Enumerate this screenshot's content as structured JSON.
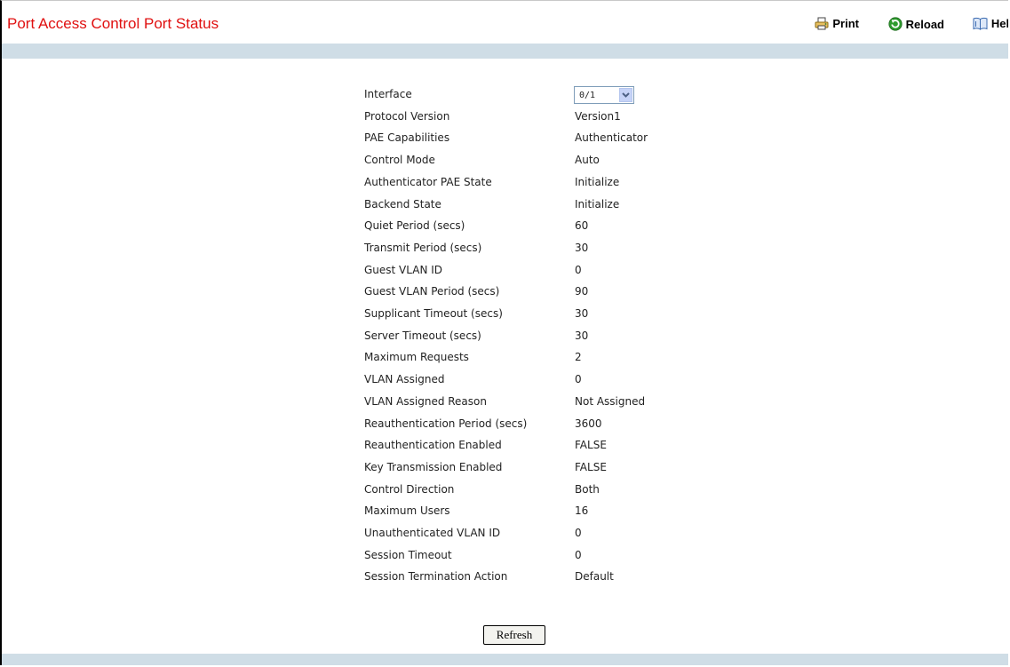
{
  "page": {
    "title": "Port Access Control Port Status"
  },
  "toolbar": {
    "print_label": "Print",
    "reload_label": "Reload",
    "help_label": "Help"
  },
  "form": {
    "interface": {
      "label": "Interface",
      "selected": "0/1"
    },
    "rows": [
      {
        "label": "Protocol Version",
        "value": "Version1"
      },
      {
        "label": "PAE Capabilities",
        "value": "Authenticator"
      },
      {
        "label": "Control Mode",
        "value": "Auto"
      },
      {
        "label": "Authenticator PAE State",
        "value": "Initialize"
      },
      {
        "label": "Backend State",
        "value": "Initialize"
      },
      {
        "label": "Quiet Period (secs)",
        "value": "60"
      },
      {
        "label": "Transmit Period (secs)",
        "value": "30"
      },
      {
        "label": "Guest VLAN ID",
        "value": "0"
      },
      {
        "label": "Guest VLAN Period (secs)",
        "value": "90"
      },
      {
        "label": "Supplicant Timeout (secs)",
        "value": "30"
      },
      {
        "label": "Server Timeout (secs)",
        "value": "30"
      },
      {
        "label": "Maximum Requests",
        "value": "2"
      },
      {
        "label": "VLAN Assigned",
        "value": "0"
      },
      {
        "label": "VLAN Assigned Reason",
        "value": "Not Assigned"
      },
      {
        "label": "Reauthentication Period (secs)",
        "value": "3600"
      },
      {
        "label": "Reauthentication Enabled",
        "value": "FALSE"
      },
      {
        "label": "Key Transmission Enabled",
        "value": "FALSE"
      },
      {
        "label": "Control Direction",
        "value": "Both"
      },
      {
        "label": "Maximum Users",
        "value": "16"
      },
      {
        "label": "Unauthenticated VLAN ID",
        "value": "0"
      },
      {
        "label": "Session Timeout",
        "value": "0"
      },
      {
        "label": "Session Termination Action",
        "value": "Default"
      }
    ]
  },
  "actions": {
    "refresh_label": "Refresh"
  },
  "colors": {
    "title": "#e01010",
    "bar": "#cfdde6",
    "reload_icon": "#2e9b2e",
    "print_icon": "#d8a020",
    "help_icon": "#3a6ab0"
  },
  "icons": {
    "print": "printer-icon",
    "reload": "reload-icon",
    "help": "help-book-icon",
    "dropdown": "chevron-down-icon"
  }
}
